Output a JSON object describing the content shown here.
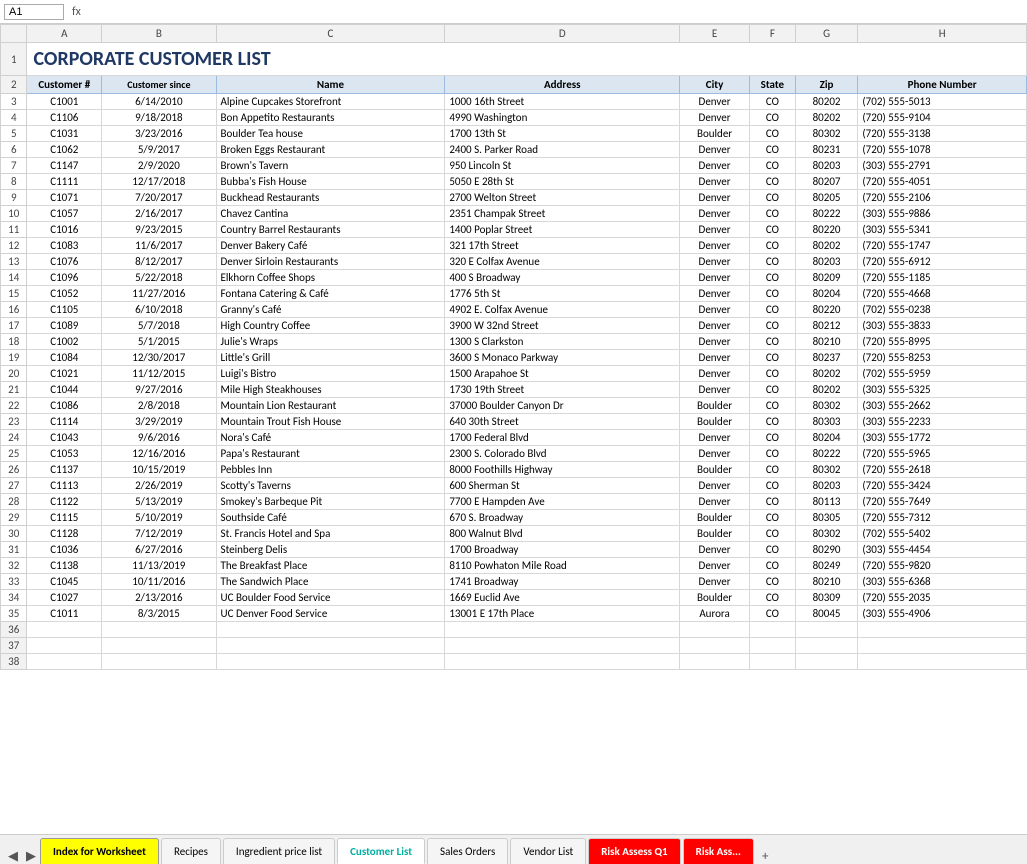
{
  "title": "CORPORATE CUSTOMER LIST",
  "nameBox": "A1",
  "formulaContent": "",
  "headers": {
    "row": [
      "",
      "A",
      "B",
      "C",
      "D",
      "E",
      "F",
      "G",
      "H"
    ],
    "colLabels": [
      "",
      "Customer #",
      "Customer since",
      "Name",
      "Address",
      "City",
      "State",
      "Zip",
      "Phone Number"
    ]
  },
  "rows": [
    {
      "num": 3,
      "a": "C1001",
      "b": "6/14/2010",
      "c": "Alpine Cupcakes Storefront",
      "d": "1000 16th Street",
      "e": "Denver",
      "f": "CO",
      "g": "80202",
      "h": "(702) 555-5013"
    },
    {
      "num": 4,
      "a": "C1106",
      "b": "9/18/2018",
      "c": "Bon Appetito Restaurants",
      "d": "4990 Washington",
      "e": "Denver",
      "f": "CO",
      "g": "80202",
      "h": "(720) 555-9104"
    },
    {
      "num": 5,
      "a": "C1031",
      "b": "3/23/2016",
      "c": "Boulder Tea house",
      "d": "1700 13th St",
      "e": "Boulder",
      "f": "CO",
      "g": "80302",
      "h": "(720) 555-3138"
    },
    {
      "num": 6,
      "a": "C1062",
      "b": "5/9/2017",
      "c": "Broken Eggs Restaurant",
      "d": "2400 S. Parker Road",
      "e": "Denver",
      "f": "CO",
      "g": "80231",
      "h": "(720) 555-1078"
    },
    {
      "num": 7,
      "a": "C1147",
      "b": "2/9/2020",
      "c": "Brown's Tavern",
      "d": "950 Lincoln St",
      "e": "Denver",
      "f": "CO",
      "g": "80203",
      "h": "(303) 555-2791"
    },
    {
      "num": 8,
      "a": "C1111",
      "b": "12/17/2018",
      "c": "Bubba's Fish House",
      "d": "5050 E 28th St",
      "e": "Denver",
      "f": "CO",
      "g": "80207",
      "h": "(720) 555-4051"
    },
    {
      "num": 9,
      "a": "C1071",
      "b": "7/20/2017",
      "c": "Buckhead Restaurants",
      "d": "2700 Welton Street",
      "e": "Denver",
      "f": "CO",
      "g": "80205",
      "h": "(720) 555-2106"
    },
    {
      "num": 10,
      "a": "C1057",
      "b": "2/16/2017",
      "c": "Chavez Cantina",
      "d": "2351 Champak Street",
      "e": "Denver",
      "f": "CO",
      "g": "80222",
      "h": "(303) 555-9886"
    },
    {
      "num": 11,
      "a": "C1016",
      "b": "9/23/2015",
      "c": "Country Barrel Restaurants",
      "d": "1400 Poplar Street",
      "e": "Denver",
      "f": "CO",
      "g": "80220",
      "h": "(303) 555-5341"
    },
    {
      "num": 12,
      "a": "C1083",
      "b": "11/6/2017",
      "c": "Denver Bakery Café",
      "d": "321 17th Street",
      "e": "Denver",
      "f": "CO",
      "g": "80202",
      "h": "(720) 555-1747"
    },
    {
      "num": 13,
      "a": "C1076",
      "b": "8/12/2017",
      "c": "Denver Sirloin Restaurants",
      "d": "320 E Colfax Avenue",
      "e": "Denver",
      "f": "CO",
      "g": "80203",
      "h": "(720) 555-6912"
    },
    {
      "num": 14,
      "a": "C1096",
      "b": "5/22/2018",
      "c": "Elkhorn Coffee Shops",
      "d": "400 S Broadway",
      "e": "Denver",
      "f": "CO",
      "g": "80209",
      "h": "(720) 555-1185"
    },
    {
      "num": 15,
      "a": "C1052",
      "b": "11/27/2016",
      "c": "Fontana Catering & Café",
      "d": "1776 5th St",
      "e": "Denver",
      "f": "CO",
      "g": "80204",
      "h": "(720) 555-4668"
    },
    {
      "num": 16,
      "a": "C1105",
      "b": "6/10/2018",
      "c": "Granny's Café",
      "d": "4902 E. Colfax Avenue",
      "e": "Denver",
      "f": "CO",
      "g": "80220",
      "h": "(702) 555-0238"
    },
    {
      "num": 17,
      "a": "C1089",
      "b": "5/7/2018",
      "c": "High Country Coffee",
      "d": "3900 W 32nd Street",
      "e": "Denver",
      "f": "CO",
      "g": "80212",
      "h": "(303) 555-3833"
    },
    {
      "num": 18,
      "a": "C1002",
      "b": "5/1/2015",
      "c": "Julie's Wraps",
      "d": "1300 S Clarkston",
      "e": "Denver",
      "f": "CO",
      "g": "80210",
      "h": "(720) 555-8995"
    },
    {
      "num": 19,
      "a": "C1084",
      "b": "12/30/2017",
      "c": "Little's Grill",
      "d": "3600 S Monaco Parkway",
      "e": "Denver",
      "f": "CO",
      "g": "80237",
      "h": "(720) 555-8253"
    },
    {
      "num": 20,
      "a": "C1021",
      "b": "11/12/2015",
      "c": "Luigi's Bistro",
      "d": "1500 Arapahoe St",
      "e": "Denver",
      "f": "CO",
      "g": "80202",
      "h": "(702) 555-5959"
    },
    {
      "num": 21,
      "a": "C1044",
      "b": "9/27/2016",
      "c": "Mile High Steakhouses",
      "d": "1730 19th Street",
      "e": "Denver",
      "f": "CO",
      "g": "80202",
      "h": "(303) 555-5325"
    },
    {
      "num": 22,
      "a": "C1086",
      "b": "2/8/2018",
      "c": "Mountain Lion Restaurant",
      "d": "37000 Boulder Canyon Dr",
      "e": "Boulder",
      "f": "CO",
      "g": "80302",
      "h": "(303) 555-2662"
    },
    {
      "num": 23,
      "a": "C1114",
      "b": "3/29/2019",
      "c": "Mountain Trout Fish House",
      "d": "640 30th Street",
      "e": "Boulder",
      "f": "CO",
      "g": "80303",
      "h": "(303) 555-2233"
    },
    {
      "num": 24,
      "a": "C1043",
      "b": "9/6/2016",
      "c": "Nora's Café",
      "d": "1700 Federal Blvd",
      "e": "Denver",
      "f": "CO",
      "g": "80204",
      "h": "(303) 555-1772"
    },
    {
      "num": 25,
      "a": "C1053",
      "b": "12/16/2016",
      "c": "Papa's Restaurant",
      "d": "2300 S. Colorado Blvd",
      "e": "Denver",
      "f": "CO",
      "g": "80222",
      "h": "(720) 555-5965"
    },
    {
      "num": 26,
      "a": "C1137",
      "b": "10/15/2019",
      "c": "Pebbles Inn",
      "d": "8000 Foothills Highway",
      "e": "Boulder",
      "f": "CO",
      "g": "80302",
      "h": "(720) 555-2618"
    },
    {
      "num": 27,
      "a": "C1113",
      "b": "2/26/2019",
      "c": "Scotty's Taverns",
      "d": "600 Sherman St",
      "e": "Denver",
      "f": "CO",
      "g": "80203",
      "h": "(720) 555-3424"
    },
    {
      "num": 28,
      "a": "C1122",
      "b": "5/13/2019",
      "c": "Smokey's Barbeque Pit",
      "d": "7700 E Hampden Ave",
      "e": "Denver",
      "f": "CO",
      "g": "80113",
      "h": "(720) 555-7649"
    },
    {
      "num": 29,
      "a": "C1115",
      "b": "5/10/2019",
      "c": "Southside Café",
      "d": "670 S. Broadway",
      "e": "Boulder",
      "f": "CO",
      "g": "80305",
      "h": "(720) 555-7312"
    },
    {
      "num": 30,
      "a": "C1128",
      "b": "7/12/2019",
      "c": "St. Francis Hotel and Spa",
      "d": "800 Walnut Blvd",
      "e": "Boulder",
      "f": "CO",
      "g": "80302",
      "h": "(702) 555-5402"
    },
    {
      "num": 31,
      "a": "C1036",
      "b": "6/27/2016",
      "c": "Steinberg Delis",
      "d": "1700 Broadway",
      "e": "Denver",
      "f": "CO",
      "g": "80290",
      "h": "(303) 555-4454"
    },
    {
      "num": 32,
      "a": "C1138",
      "b": "11/13/2019",
      "c": "The Breakfast Place",
      "d": "8110 Powhaton Mile Road",
      "e": "Denver",
      "f": "CO",
      "g": "80249",
      "h": "(720) 555-9820"
    },
    {
      "num": 33,
      "a": "C1045",
      "b": "10/11/2016",
      "c": "The Sandwich Place",
      "d": "1741 Broadway",
      "e": "Denver",
      "f": "CO",
      "g": "80210",
      "h": "(303) 555-6368"
    },
    {
      "num": 34,
      "a": "C1027",
      "b": "2/13/2016",
      "c": "UC Boulder Food Service",
      "d": "1669 Euclid Ave",
      "e": "Boulder",
      "f": "CO",
      "g": "80309",
      "h": "(720) 555-2035"
    },
    {
      "num": 35,
      "a": "C1011",
      "b": "8/3/2015",
      "c": "UC Denver Food Service",
      "d": "13001 E 17th Place",
      "e": "Aurora",
      "f": "CO",
      "g": "80045",
      "h": "(303) 555-4906"
    }
  ],
  "emptyRows": [
    36,
    37,
    38
  ],
  "tabs": [
    {
      "label": "Index for Worksheet",
      "style": "highlighted-yellow"
    },
    {
      "label": "Recipes",
      "style": "normal"
    },
    {
      "label": "Ingredient price list",
      "style": "normal"
    },
    {
      "label": "Customer List",
      "style": "highlighted-teal"
    },
    {
      "label": "Sales Orders",
      "style": "normal"
    },
    {
      "label": "Vendor List",
      "style": "normal"
    },
    {
      "label": "Risk Assess Q1",
      "style": "highlighted-red"
    },
    {
      "label": "Risk Ass...",
      "style": "highlighted-red"
    }
  ],
  "moreTabsLabel": "...",
  "addSheetLabel": "+"
}
